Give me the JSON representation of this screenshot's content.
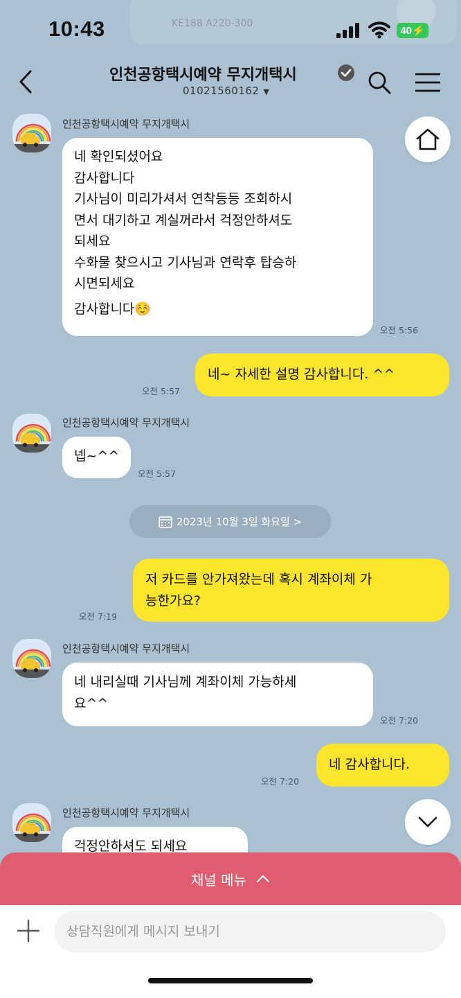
{
  "status": {
    "time": "10:43",
    "battery": "40",
    "notification_peek": "KE188  A220-300"
  },
  "header": {
    "title": "인천공항택시예약 무지개택시",
    "phone": "01021560162"
  },
  "chat": {
    "group1": {
      "sender": "인천공항택시예약 무지개택시",
      "lines": [
        "네 확인되셨어요",
        "감사합니다",
        "기사님이 미리가셔서 연착등등 조회하시",
        "면서 대기하고 계실꺼라서 걱정안하셔도",
        "되세요",
        "수화물 찾으시고 기사님과 연락후 탑승하",
        "시면되세요",
        "감사합니다☺️"
      ],
      "time": "오전 5:56"
    },
    "out1": {
      "text": "네~ 자세한 설명 감사합니다. ^^",
      "time": "오전 5:57"
    },
    "group2": {
      "sender": "인천공항택시예약 무지개택시",
      "text": "넵~^^",
      "time": "오전 5:57"
    },
    "date_divider": "2023년 10월 3일 화요일 >",
    "out2": {
      "lines": [
        "저 카드를 안가져왔는데 혹시 계좌이체 가",
        "능한가요?"
      ],
      "time": "오전 7:19"
    },
    "group3": {
      "sender": "인천공항택시예약 무지개택시",
      "lines": [
        "네 내리실때 기사님께 계좌이체 가능하세",
        "요^^"
      ],
      "time": "오전 7:20"
    },
    "out3": {
      "text": "네 감사합니다.",
      "time": "오전 7:20"
    },
    "group4": {
      "sender": "인천공항택시예약 무지개택시",
      "text": "걱정안하셔도 되세요"
    }
  },
  "bottom": {
    "channel_menu": "채널 메뉴",
    "input_placeholder": "상담직원에게 메시지 보내기"
  },
  "colors": {
    "background": "#abc1d1",
    "outgoing_bubble": "#fde42d",
    "channel_menu": "#e05c6f"
  }
}
